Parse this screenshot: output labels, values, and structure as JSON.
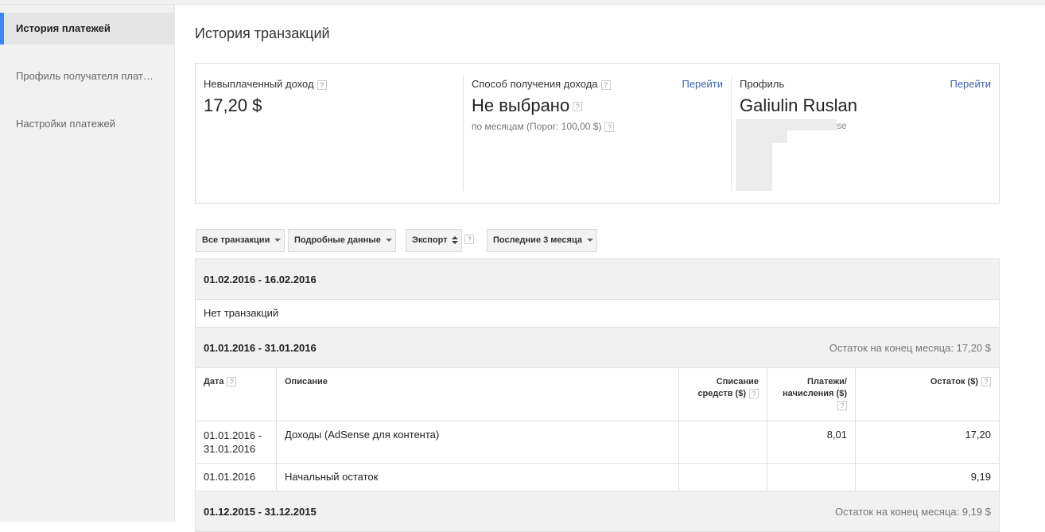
{
  "sidebar": {
    "items": [
      {
        "label": "История платежей",
        "active": true
      },
      {
        "label": "Профиль получателя плат…",
        "active": false
      },
      {
        "label": "Настройки платежей",
        "active": false
      }
    ]
  },
  "page": {
    "title": "История транзакций"
  },
  "summary": {
    "unpaid": {
      "label": "Невыплаченный доход",
      "value": "17,20 $"
    },
    "method": {
      "label": "Способ получения дохода",
      "link": "Перейти",
      "value": "Не выбрано",
      "sub": "по месяцам (Порог: 100,00 $)"
    },
    "profile": {
      "label": "Профиль",
      "link": "Перейти",
      "name": "Galiulin Ruslan",
      "address_fragment": "se"
    }
  },
  "toolbar": {
    "filter": "Все транзакции",
    "details": "Подробные данные",
    "export": "Экспорт",
    "range": "Последние 3 месяца"
  },
  "help_glyph": "?",
  "periods": [
    {
      "dates": "01.02.2016 - 16.02.2016",
      "message": "Нет транзакций"
    },
    {
      "dates": "01.01.2016 - 31.01.2016",
      "balance": "Остаток на конец месяца: 17,20 $"
    },
    {
      "dates": "01.12.2015 - 31.12.2015",
      "balance": "Остаток на конец месяца: 9,19 $"
    }
  ],
  "table": {
    "headers": {
      "date": "Дата",
      "description": "Описание",
      "debit": "Списание средств ($)",
      "payments": "Платежи/ начисления ($)",
      "balance": "Остаток ($)"
    },
    "rows": [
      {
        "date": "01.01.2016 - 31.01.2016",
        "description": "Доходы (AdSense для контента)",
        "debit": "",
        "payments": "8,01",
        "balance": "17,20"
      },
      {
        "date": "01.01.2016",
        "description": "Начальный остаток",
        "debit": "",
        "payments": "",
        "balance": "9,19"
      }
    ]
  },
  "colors": {
    "accent": "#4285f4",
    "link": "#3b63a8",
    "sidebar_bg": "#f1f1f1"
  }
}
